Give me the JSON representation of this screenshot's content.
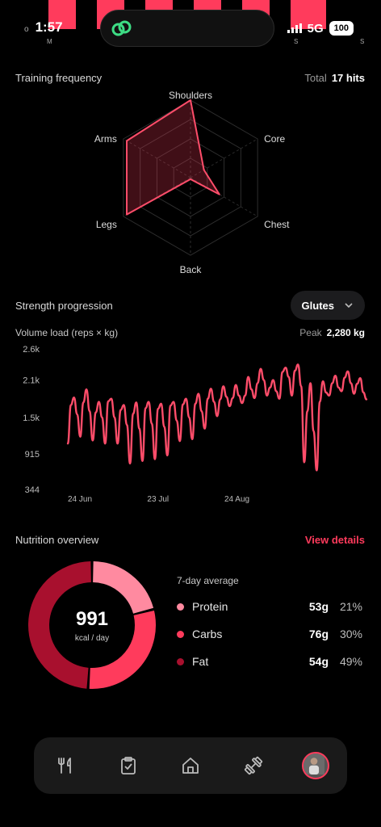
{
  "status_bar": {
    "time": "1:57",
    "network": "5G",
    "battery": "100",
    "left_glyph": "o",
    "left_sub": "M",
    "right_sub_1": "S",
    "right_sub_2": "S"
  },
  "training": {
    "title": "Training frequency",
    "total_label": "Total",
    "total_value": "17 hits",
    "axes": [
      "Shoulders",
      "Core",
      "Chest",
      "Back",
      "Legs",
      "Arms"
    ],
    "values_fraction": [
      1.0,
      0.2,
      0.43,
      0.0,
      0.95,
      0.95
    ]
  },
  "strength": {
    "title": "Strength progression",
    "dropdown_value": "Glutes",
    "volume_label": "Volume load (reps × kg)",
    "peak_label": "Peak",
    "peak_value": "2,280 kg"
  },
  "chart_data": {
    "type": "line",
    "title": "",
    "ylabel": "Volume load (reps × kg)",
    "y_ticks": [
      "2.6k",
      "2.1k",
      "1.5k",
      "915",
      "344"
    ],
    "y_tick_values": [
      2600,
      2100,
      1500,
      915,
      344
    ],
    "x_ticks": [
      "24 Jun",
      "23 Jul",
      "24 Aug"
    ],
    "x_tick_positions": [
      0,
      29,
      61
    ],
    "ylim": [
      344,
      2600
    ],
    "color": "#ff4d6a",
    "series": [
      {
        "values": [
          1080,
          1700,
          1820,
          1550,
          1190,
          1740,
          1950,
          1600,
          1130,
          1580,
          1750,
          1500,
          1080,
          1760,
          1800,
          1500,
          1080,
          1620,
          1700,
          1380,
          760,
          1560,
          1740,
          1320,
          800,
          1650,
          1750,
          1400,
          830,
          1640,
          1720,
          1350,
          890,
          1690,
          1750,
          1450,
          1120,
          1710,
          1800,
          1500,
          1150,
          1720,
          1880,
          1600,
          1320,
          1800,
          1960,
          1750,
          1520,
          1790,
          2000,
          1830,
          1680,
          1810,
          2020,
          1850,
          1730,
          1850,
          2150,
          1950,
          1810,
          2050,
          2280,
          2100,
          1850,
          1980,
          2100,
          1920,
          1800,
          2230,
          2300,
          2150,
          1850,
          2250,
          2350,
          2000,
          780,
          1600,
          2050,
          1280,
          650,
          1750,
          2080,
          1900,
          1850,
          2050,
          2170,
          1980,
          1920,
          2140,
          2240,
          2050,
          1880,
          2040,
          2130,
          1900,
          1790
        ]
      }
    ]
  },
  "nutrition": {
    "title": "Nutrition overview",
    "link": "View details",
    "kcal": "991",
    "kcal_unit": "kcal / day",
    "avg_title": "7-day average",
    "macros": [
      {
        "name": "Protein",
        "grams": "53g",
        "pct": "21%",
        "color": "#ff8aa0"
      },
      {
        "name": "Carbs",
        "grams": "76g",
        "pct": "30%",
        "color": "#ff3b5c"
      },
      {
        "name": "Fat",
        "grams": "54g",
        "pct": "49%",
        "color": "#a8102e"
      }
    ],
    "donut_fractions": [
      0.21,
      0.3,
      0.49
    ]
  },
  "nav": {
    "items": [
      "fork-knife-icon",
      "clipboard-icon",
      "home-icon",
      "dumbbell-icon",
      "avatar"
    ]
  }
}
